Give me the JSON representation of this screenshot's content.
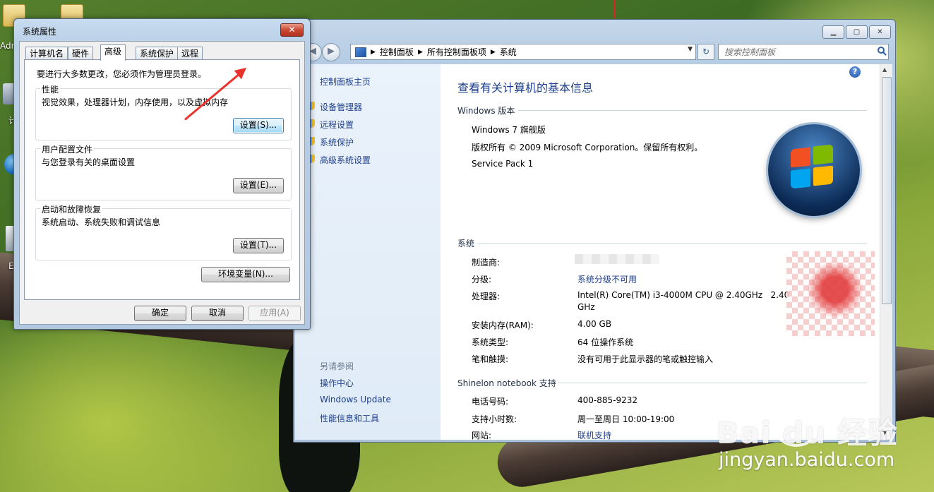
{
  "desktop": {
    "icon_labels": [
      "Adr",
      "计",
      "E"
    ]
  },
  "control_panel": {
    "address": {
      "items": [
        "控制面板",
        "所有控制面板项",
        "系统"
      ]
    },
    "search": {
      "placeholder": "搜索控制面板"
    },
    "left_nav": {
      "home": "控制面板主页",
      "links": [
        "设备管理器",
        "远程设置",
        "系统保护",
        "高级系统设置"
      ],
      "see_also_title": "另请参阅",
      "see_also_links": [
        "操作中心",
        "Windows Update",
        "性能信息和工具"
      ]
    },
    "main": {
      "title": "查看有关计算机的基本信息",
      "edition_section": "Windows 版本",
      "edition": "Windows 7 旗舰版",
      "copyright": "版权所有 © 2009 Microsoft Corporation。保留所有权利。",
      "service_pack": "Service Pack 1",
      "system_section": "系统",
      "rows": [
        {
          "label": "制造商:",
          "value": ""
        },
        {
          "label": "分级:",
          "value": "系统分级不可用"
        },
        {
          "label": "处理器:",
          "value": "Intel(R) Core(TM) i3-4000M CPU @ 2.40GHz   2.40",
          "value2": "GHz"
        },
        {
          "label": "安装内存(RAM):",
          "value": "4.00 GB"
        },
        {
          "label": "系统类型:",
          "value": "64 位操作系统"
        },
        {
          "label": "笔和触摸:",
          "value": "没有可用于此显示器的笔或触控输入"
        }
      ],
      "support_section": "Shinelon notebook 支持",
      "support_rows": [
        {
          "label": "电话号码:",
          "value": "400-885-9232"
        },
        {
          "label": "支持小时数:",
          "value": "周一至周日 10:00-19:00"
        },
        {
          "label": "网站:",
          "value": "联机支持"
        }
      ]
    }
  },
  "system_properties": {
    "title": "系统属性",
    "close_label": "✕",
    "tabs": [
      "计算机名",
      "硬件",
      "高级",
      "系统保护",
      "远程"
    ],
    "active_tab": "高级",
    "admin_note": "要进行大多数更改，您必须作为管理员登录。",
    "groups": [
      {
        "title": "性能",
        "desc": "视觉效果，处理器计划，内存使用，以及虚拟内存",
        "button": "设置(S)..."
      },
      {
        "title": "用户配置文件",
        "desc": "与您登录有关的桌面设置",
        "button": "设置(E)..."
      },
      {
        "title": "启动和故障恢复",
        "desc": "系统启动、系统失败和调试信息",
        "button": "设置(T)..."
      }
    ],
    "env_button": "环境变量(N)...",
    "ok": "确定",
    "cancel": "取消",
    "apply": "应用(A)"
  },
  "watermark": {
    "brand": "Bai  du 经验",
    "url": "jingyan.baidu.com"
  },
  "colors": {
    "link": "#1e3f8c",
    "arrow": "#e8322b",
    "close_button": "#c94a35"
  }
}
